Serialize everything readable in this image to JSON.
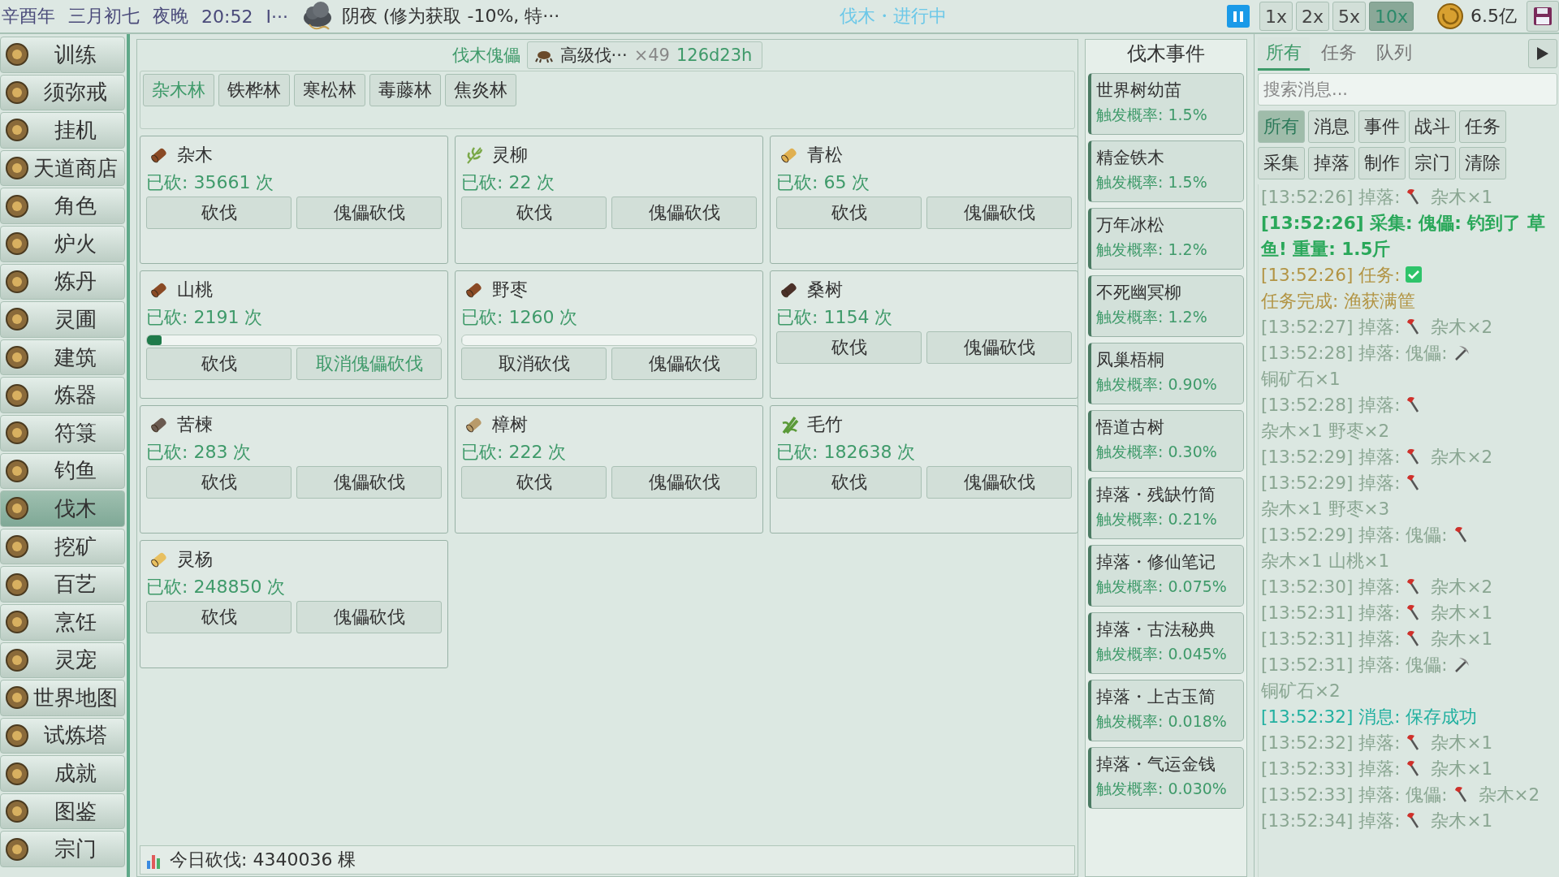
{
  "top_bar": {
    "date_parts": [
      "辛酉年",
      "三月初七",
      "夜晚",
      "20:52",
      "I···"
    ],
    "weather": "阴夜 (修为获取 -10%, 特···",
    "activity": "伐木・进行中",
    "paused": false,
    "speeds": [
      {
        "label": "1x",
        "selected": false
      },
      {
        "label": "2x",
        "selected": false
      },
      {
        "label": "5x",
        "selected": false
      },
      {
        "label": "10x",
        "selected": true
      }
    ],
    "money": "6.5亿"
  },
  "sidebar": {
    "items": [
      {
        "label": "训练",
        "selected": false
      },
      {
        "label": "须弥戒",
        "selected": false
      },
      {
        "label": "挂机",
        "selected": false
      },
      {
        "label": "天道商店",
        "selected": false
      },
      {
        "label": "角色",
        "selected": false
      },
      {
        "label": "炉火",
        "selected": false
      },
      {
        "label": "炼丹",
        "selected": false
      },
      {
        "label": "灵圃",
        "selected": false
      },
      {
        "label": "建筑",
        "selected": false
      },
      {
        "label": "炼器",
        "selected": false
      },
      {
        "label": "符箓",
        "selected": false
      },
      {
        "label": "钓鱼",
        "selected": false
      },
      {
        "label": "伐木",
        "selected": true
      },
      {
        "label": "挖矿",
        "selected": false
      },
      {
        "label": "百艺",
        "selected": false
      },
      {
        "label": "烹饪",
        "selected": false
      },
      {
        "label": "灵宠",
        "selected": false
      },
      {
        "label": "世界地图",
        "selected": false
      },
      {
        "label": "试炼塔",
        "selected": false
      },
      {
        "label": "成就",
        "selected": false
      },
      {
        "label": "图鉴",
        "selected": false
      },
      {
        "label": "宗门",
        "selected": false
      }
    ]
  },
  "woodcutting": {
    "puppet_label": "伐木傀儡",
    "puppet": {
      "name": "高级伐···",
      "count": "×49",
      "time": "126d23h"
    },
    "tabs": [
      {
        "label": "杂木林",
        "selected": true
      },
      {
        "label": "铁桦林",
        "selected": false
      },
      {
        "label": "寒松林",
        "selected": false
      },
      {
        "label": "毒藤林",
        "selected": false
      },
      {
        "label": "焦炎林",
        "selected": false
      }
    ],
    "trees": [
      {
        "name": "杂木",
        "kind": "log",
        "color": "#8a4a25",
        "count": "已砍: 35661 次",
        "buttons": [
          {
            "label": "砍伐",
            "highlighted": false
          },
          {
            "label": "傀儡砍伐",
            "highlighted": false
          }
        ]
      },
      {
        "name": "灵柳",
        "kind": "sprig",
        "color": "#7aa848",
        "count": "已砍: 22 次",
        "buttons": [
          {
            "label": "砍伐",
            "highlighted": false
          },
          {
            "label": "傀儡砍伐",
            "highlighted": false
          }
        ]
      },
      {
        "name": "青松",
        "kind": "log",
        "color": "#e0b050",
        "count": "已砍: 65 次",
        "buttons": [
          {
            "label": "砍伐",
            "highlighted": false
          },
          {
            "label": "傀儡砍伐",
            "highlighted": false
          }
        ]
      },
      {
        "name": "山桃",
        "kind": "log",
        "color": "#8a4a25",
        "count": "已砍: 2191 次",
        "progress": {
          "level": 0.05
        },
        "buttons": [
          {
            "label": "砍伐",
            "highlighted": false
          },
          {
            "label": "取消傀儡砍伐",
            "highlighted": true
          }
        ]
      },
      {
        "name": "野枣",
        "kind": "log",
        "color": "#8a4a25",
        "count": "已砍: 1260 次",
        "progress": {
          "level": 0
        },
        "buttons": [
          {
            "label": "取消砍伐",
            "highlighted": false
          },
          {
            "label": "傀儡砍伐",
            "highlighted": false
          }
        ]
      },
      {
        "name": "桑树",
        "kind": "log",
        "color": "#4a3028",
        "count": "已砍: 1154 次",
        "buttons": [
          {
            "label": "砍伐",
            "highlighted": false
          },
          {
            "label": "傀儡砍伐",
            "highlighted": false
          }
        ]
      },
      {
        "name": "苦楝",
        "kind": "log",
        "color": "#6a5a50",
        "count": "已砍: 283 次",
        "buttons": [
          {
            "label": "砍伐",
            "highlighted": false
          },
          {
            "label": "傀儡砍伐",
            "highlighted": false
          }
        ]
      },
      {
        "name": "樟树",
        "kind": "log",
        "color": "#b89a6a",
        "count": "已砍: 222 次",
        "buttons": [
          {
            "label": "砍伐",
            "highlighted": false
          },
          {
            "label": "傀儡砍伐",
            "highlighted": false
          }
        ]
      },
      {
        "name": "毛竹",
        "kind": "bamboo",
        "color": "#5a9a38",
        "count": "已砍: 182638 次",
        "buttons": [
          {
            "label": "砍伐",
            "highlighted": false
          },
          {
            "label": "傀儡砍伐",
            "highlighted": false
          }
        ]
      },
      {
        "name": "灵杨",
        "kind": "log",
        "color": "#e8c060",
        "count": "已砍: 248850 次",
        "buttons": [
          {
            "label": "砍伐",
            "highlighted": false
          },
          {
            "label": "傀儡砍伐",
            "highlighted": false
          }
        ]
      }
    ],
    "today": "今日砍伐: 4340036 棵"
  },
  "events": {
    "title": "伐木事件",
    "items": [
      {
        "name": "世界树幼苗",
        "rate": "触发概率: 1.5%"
      },
      {
        "name": "精金铁木",
        "rate": "触发概率: 1.5%"
      },
      {
        "name": "万年冰松",
        "rate": "触发概率: 1.2%"
      },
      {
        "name": "不死幽冥柳",
        "rate": "触发概率: 1.2%"
      },
      {
        "name": "凤巢梧桐",
        "rate": "触发概率: 0.90%"
      },
      {
        "name": "悟道古树",
        "rate": "触发概率: 0.30%"
      },
      {
        "name": "掉落・残缺竹简",
        "rate": "触发概率: 0.21%"
      },
      {
        "name": "掉落・修仙笔记",
        "rate": "触发概率: 0.075%"
      },
      {
        "name": "掉落・古法秘典",
        "rate": "触发概率: 0.045%"
      },
      {
        "name": "掉落・上古玉简",
        "rate": "触发概率: 0.018%"
      },
      {
        "name": "掉落・气运金钱",
        "rate": "触发概率: 0.030%"
      }
    ]
  },
  "log": {
    "tabs": [
      {
        "label": "所有",
        "selected": true
      },
      {
        "label": "任务",
        "selected": false
      },
      {
        "label": "队列",
        "selected": false
      }
    ],
    "search": {
      "placeholder": "搜索消息..."
    },
    "filters": [
      {
        "label": "所有",
        "selected": true
      },
      {
        "label": "消息",
        "selected": false
      },
      {
        "label": "事件",
        "selected": false
      },
      {
        "label": "战斗",
        "selected": false
      },
      {
        "label": "任务",
        "selected": false
      },
      {
        "label": "采集",
        "selected": false
      },
      {
        "label": "掉落",
        "selected": false
      },
      {
        "label": "制作",
        "selected": false
      },
      {
        "label": "宗门",
        "selected": false
      },
      {
        "label": "清除",
        "selected": false
      }
    ],
    "entries": [
      {
        "kind": "drop",
        "head": "[13:52:26] 掉落:",
        "item": {
          "kind": "axe",
          "text": "杂木×1"
        }
      },
      {
        "kind": "gather",
        "head": "[13:52:26] 采集: 傀儡: 钓到了 草鱼! 重量: 1.5斤"
      },
      {
        "kind": "task",
        "head": "[13:52:26] 任务:",
        "item": {
          "kind": "check",
          "text": "任务完成: 渔获满筐"
        }
      },
      {
        "kind": "drop",
        "head": "[13:52:27] 掉落:",
        "item": {
          "kind": "axe",
          "text": "杂木×2"
        }
      },
      {
        "kind": "drop",
        "head": "[13:52:28] 掉落: 傀儡:",
        "item": {
          "kind": "pickaxe",
          "text": "铜矿石×1"
        }
      },
      {
        "kind": "drop",
        "head": "[13:52:28] 掉落:",
        "item": {
          "kind": "axe",
          "text": "杂木×1 野枣×2"
        }
      },
      {
        "kind": "drop",
        "head": "[13:52:29] 掉落:",
        "item": {
          "kind": "axe",
          "text": "杂木×2"
        }
      },
      {
        "kind": "drop",
        "head": "[13:52:29] 掉落:",
        "item": {
          "kind": "axe",
          "text": "杂木×1 野枣×3"
        }
      },
      {
        "kind": "drop",
        "head": "[13:52:29] 掉落: 傀儡:",
        "item": {
          "kind": "axe",
          "text": "杂木×1 山桃×1"
        }
      },
      {
        "kind": "drop",
        "head": "[13:52:30] 掉落:",
        "item": {
          "kind": "axe",
          "text": "杂木×2"
        }
      },
      {
        "kind": "drop",
        "head": "[13:52:31] 掉落:",
        "item": {
          "kind": "axe",
          "text": "杂木×1"
        }
      },
      {
        "kind": "drop",
        "head": "[13:52:31] 掉落:",
        "item": {
          "kind": "axe",
          "text": "杂木×1"
        }
      },
      {
        "kind": "drop",
        "head": "[13:52:31] 掉落: 傀儡:",
        "item": {
          "kind": "pickaxe",
          "text": "铜矿石×2"
        }
      },
      {
        "kind": "message",
        "head": "[13:52:32] 消息: 保存成功"
      },
      {
        "kind": "drop",
        "head": "[13:52:32] 掉落:",
        "item": {
          "kind": "axe",
          "text": "杂木×1"
        }
      },
      {
        "kind": "drop",
        "head": "[13:52:33] 掉落:",
        "item": {
          "kind": "axe",
          "text": "杂木×1"
        }
      },
      {
        "kind": "drop",
        "head": "[13:52:33] 掉落: 傀儡:",
        "item": {
          "kind": "axe",
          "text": "杂木×2"
        }
      },
      {
        "kind": "drop",
        "head": "[13:52:34] 掉落:",
        "item": {
          "kind": "axe",
          "text": "杂木×1"
        }
      }
    ]
  }
}
